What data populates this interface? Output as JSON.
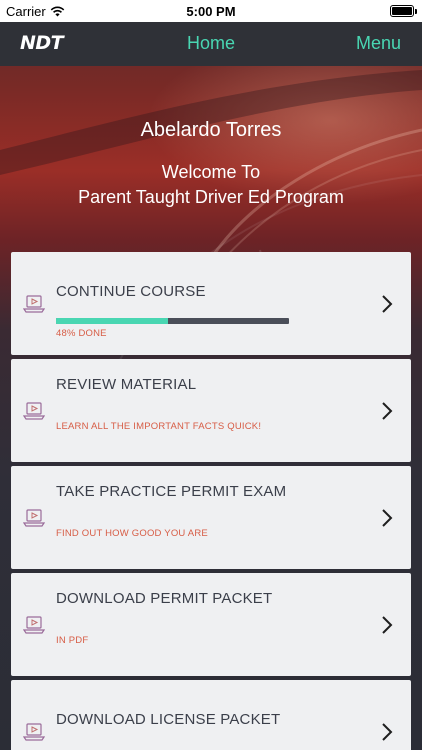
{
  "status_bar": {
    "carrier": "Carrier",
    "time": "5:00 PM"
  },
  "nav": {
    "logo": "NDT",
    "home_label": "Home",
    "menu_label": "Menu",
    "accent_color": "#49d6b2"
  },
  "hero": {
    "user_name": "Abelardo Torres",
    "welcome_line1": "Welcome To",
    "welcome_line2": "Parent Taught Driver Ed Program"
  },
  "cards": [
    {
      "icon": "laptop-video-icon",
      "title": "CONTINUE COURSE",
      "subtitle": "48% DONE",
      "progress": 0.48
    },
    {
      "icon": "laptop-video-icon",
      "title": "REVIEW MATERIAL",
      "subtitle": "LEARN ALL THE IMPORTANT FACTS QUICK!"
    },
    {
      "icon": "laptop-video-icon",
      "title": "TAKE PRACTICE PERMIT EXAM",
      "subtitle": "FIND OUT HOW GOOD YOU ARE"
    },
    {
      "icon": "laptop-video-icon",
      "title": "DOWNLOAD PERMIT PACKET",
      "subtitle": "IN PDF"
    },
    {
      "icon": "laptop-video-icon",
      "title": "DOWNLOAD LICENSE PACKET",
      "subtitle": ""
    }
  ],
  "colors": {
    "subtitle": "#d75d46",
    "progress_fill": "#49d6b2",
    "progress_track": "#4a4e59"
  }
}
